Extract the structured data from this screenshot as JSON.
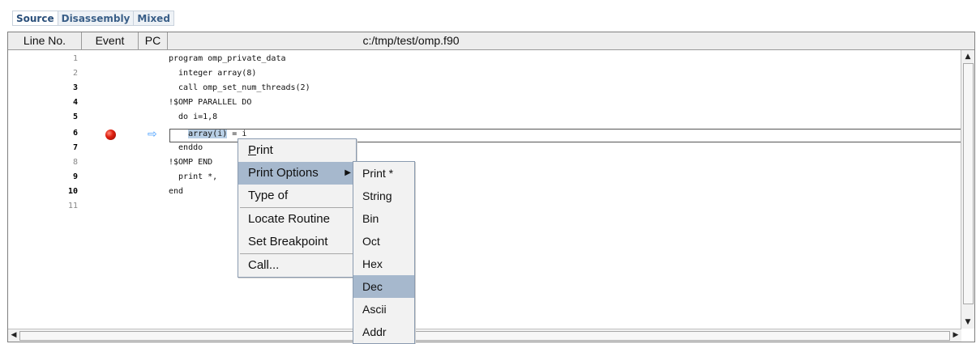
{
  "tabs": [
    "Source",
    "Disassembly",
    "Mixed"
  ],
  "columns": {
    "line_no": "Line No.",
    "event": "Event",
    "pc": "PC",
    "file": "c:/tmp/test/omp.f90"
  },
  "lines": [
    {
      "n": "1",
      "code": "program omp_private_data"
    },
    {
      "n": "2",
      "code": "  integer array(8)"
    },
    {
      "n": "3",
      "code": "  call omp_set_num_threads(2)"
    },
    {
      "n": "4",
      "code": "!$OMP PARALLEL DO"
    },
    {
      "n": "5",
      "code": "  do i=1,8"
    },
    {
      "n": "6",
      "code_pre": "    ",
      "code_sel": "array(i)",
      "code_post": " = i"
    },
    {
      "n": "7",
      "code": "  enddo"
    },
    {
      "n": "8",
      "code": "!$OMP END"
    },
    {
      "n": "9",
      "code": "  print *,"
    },
    {
      "n": "10",
      "code": "end"
    },
    {
      "n": "11",
      "code": ""
    }
  ],
  "context_menu": [
    "Print",
    "Print Options",
    "Type of",
    "Locate Routine",
    "Set Breakpoint",
    "Call..."
  ],
  "submenu": [
    "Print *",
    "String",
    "Bin",
    "Oct",
    "Hex",
    "Dec",
    "Ascii",
    "Addr"
  ]
}
